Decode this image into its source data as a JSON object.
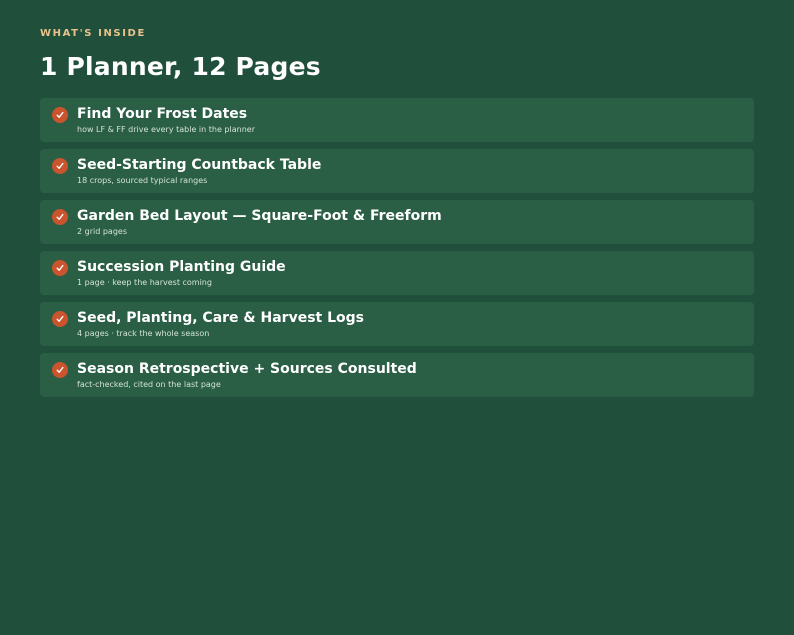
{
  "header": {
    "eyebrow": "WHAT'S INSIDE",
    "title": "1 Planner, 12 Pages"
  },
  "items": [
    {
      "title": "Find Your Frost Dates",
      "subtitle": "how LF & FF drive every table in the planner",
      "icon": "check-icon"
    },
    {
      "title": "Seed-Starting Countback Table",
      "subtitle": "18 crops, sourced typical ranges",
      "icon": "check-icon"
    },
    {
      "title": "Garden Bed Layout — Square-Foot & Freeform",
      "subtitle": "2 grid pages",
      "icon": "check-icon"
    },
    {
      "title": "Succession Planting Guide",
      "subtitle": "1 page · keep the harvest coming",
      "icon": "check-icon"
    },
    {
      "title": "Seed, Planting, Care & Harvest Logs",
      "subtitle": "4 pages · track the whole season",
      "icon": "check-icon"
    },
    {
      "title": "Season Retrospective + Sources Consulted",
      "subtitle": "fact-checked, cited on the last page",
      "icon": "check-icon"
    }
  ],
  "colors": {
    "background": "#204f3b",
    "card": "#2a5f46",
    "accent": "#c9542e",
    "eyebrow": "#e8c48c"
  }
}
